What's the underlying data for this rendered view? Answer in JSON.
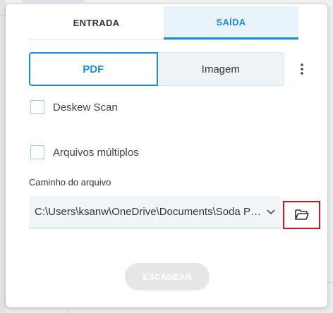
{
  "tabs": [
    {
      "label": "ENTRADA",
      "active": false
    },
    {
      "label": "SAÍDA",
      "active": true
    }
  ],
  "format": {
    "options": [
      "PDF",
      "Imagem"
    ],
    "selected": "PDF"
  },
  "more_menu": {
    "icon": "more-vert-icon"
  },
  "options": {
    "deskew_label": "Deskew Scan",
    "deskew_checked": false,
    "multi_label": "Arquivos múltiplos",
    "multi_checked": false
  },
  "path": {
    "label": "Caminho do arquivo",
    "value": "C:\\Users\\ksanw\\OneDrive\\Documents\\Soda PDF",
    "dropdown_icon": "chevron-down-icon",
    "browse_icon": "folder-open-icon"
  },
  "scan_button": {
    "label": "ESCANEAR",
    "enabled": false
  },
  "colors": {
    "accent": "#1b8fd6",
    "tab_active_bg": "#e8f3fb",
    "highlight_border": "#e0101a",
    "disabled_button": "#e6e6e6"
  }
}
